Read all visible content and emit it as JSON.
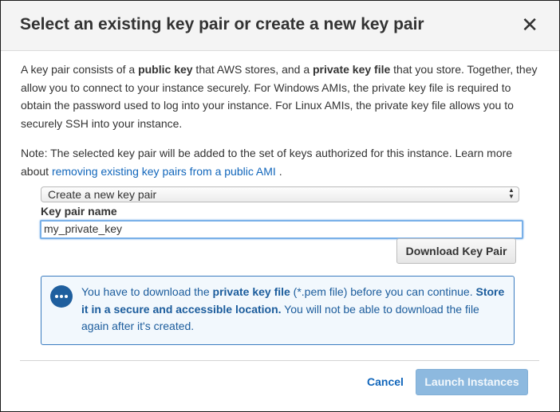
{
  "dialog": {
    "title": "Select an existing key pair or create a new key pair",
    "close_glyph": "✕"
  },
  "intro": {
    "t1": "A key pair consists of a ",
    "b1": "public key",
    "t2": " that AWS stores, and a ",
    "b2": "private key file",
    "t3": " that you store. Together, they allow you to connect to your instance securely. For Windows AMIs, the private key file is required to obtain the password used to log into your instance. For Linux AMIs, the private key file allows you to securely SSH into your instance."
  },
  "note": {
    "t1": "Note: The selected key pair will be added to the set of keys authorized for this instance. Learn more about ",
    "link": "removing existing key pairs from a public AMI",
    "t2": " ."
  },
  "keypair_select": {
    "selected": "Create a new key pair"
  },
  "keypair_name": {
    "label": "Key pair name",
    "value": "my_private_key"
  },
  "download_button": "Download Key Pair",
  "info_box": {
    "icon": "chat-bubble-icon",
    "t1": "You have to download the ",
    "b1": "private key file",
    "t2": " (*.pem file) before you can continue. ",
    "b2": "Store it in a secure and accessible location.",
    "t3": " You will not be able to download the file again after it's created."
  },
  "footer": {
    "cancel": "Cancel",
    "launch": "Launch Instances"
  },
  "colors": {
    "link": "#1166bb",
    "info_border": "#3b7cc0",
    "info_icon": "#1f5f9e",
    "launch_disabled": "#8db9df"
  }
}
